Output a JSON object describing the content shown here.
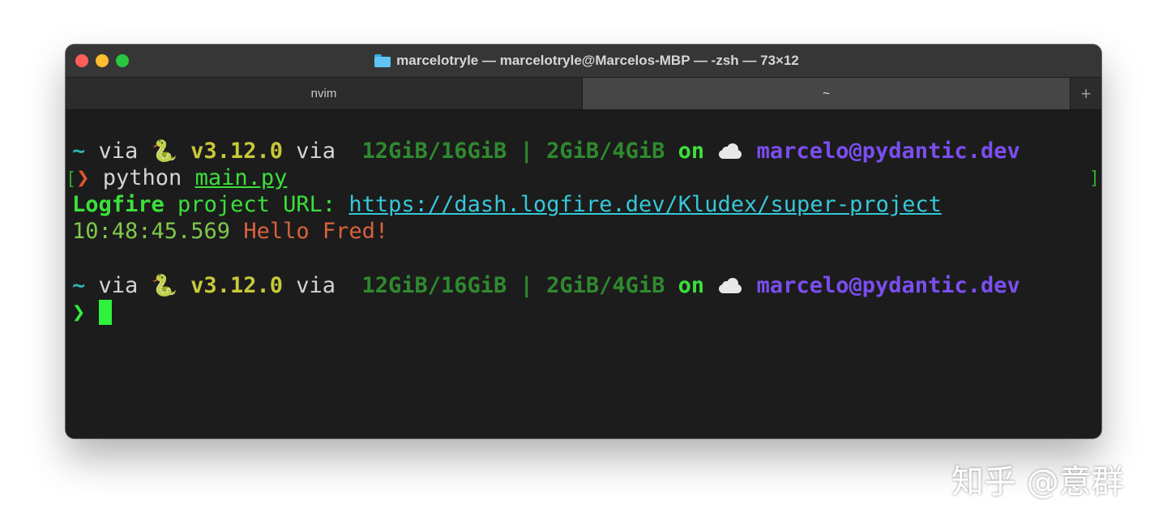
{
  "window": {
    "title": "marcelotryle — marcelotryle@Marcelos-MBP — -zsh — 73×12",
    "folder_icon": "folder-icon"
  },
  "tabs": [
    {
      "label": "nvim",
      "active": false
    },
    {
      "label": "~",
      "active": true
    }
  ],
  "new_tab_label": "+",
  "prompt1": {
    "dir": "~",
    "via1": " via ",
    "snake": "🐍",
    "version": " v3.12.0",
    "via2": " via ",
    "mem": " 12GiB/16GiB | 2GiB/4GiB",
    "on": " on ",
    "cloud": "cloud-icon",
    "account": " marcelo@pydantic.dev"
  },
  "command": {
    "open_bracket": "[",
    "chevron": "❯",
    "cmd": " python ",
    "file": "main.py",
    "close_bracket": "]"
  },
  "output": {
    "logfire": "Logfire",
    "project_url_label": " project URL: ",
    "url": "https://dash.logfire.dev/Kludex/super-project",
    "timestamp": "10:48:45.569",
    "message": " Hello Fred!"
  },
  "prompt2": {
    "dir": "~",
    "via1": " via ",
    "snake": "🐍",
    "version": " v3.12.0",
    "via2": " via ",
    "mem": " 12GiB/16GiB | 2GiB/4GiB",
    "on": " on ",
    "cloud": "cloud-icon",
    "account": " marcelo@pydantic.dev"
  },
  "input_prompt": {
    "chevron": "❯"
  },
  "watermark": "知乎 @意群",
  "colors": {
    "red_dot": "#ff5f57",
    "yellow_dot": "#febc2e",
    "green_dot": "#28c840",
    "cyan": "#2fb4b4",
    "text": "#d4d4d4",
    "yellow": "#c8c83a",
    "dark_green": "#2f8a2f",
    "bright_green": "#3be03b",
    "purple": "#7b4ef0",
    "orange": "#e0542f",
    "link": "#35c8d8",
    "salmon": "#d9623d",
    "timestamp": "#7fc94e"
  }
}
